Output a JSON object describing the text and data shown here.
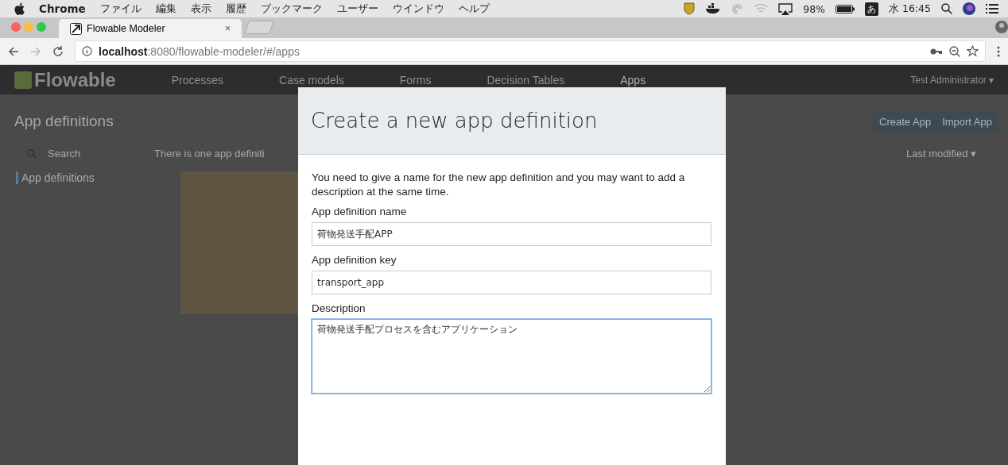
{
  "menu_bar": {
    "app": "Chrome",
    "items": [
      "ファイル",
      "編集",
      "表示",
      "履歴",
      "ブックマーク",
      "ユーザー",
      "ウインドウ",
      "ヘルプ"
    ],
    "battery": "98%",
    "input_method": "あ",
    "clock": "水 16:45"
  },
  "browser": {
    "tabs": [
      {
        "title": "Flowable Modeler",
        "close": "×",
        "selected": true
      }
    ],
    "url_host": "localhost",
    "url_path": ":8080/flowable-modeler/#/apps"
  },
  "app": {
    "logo": "Flowable",
    "nav": [
      {
        "label": "Processes",
        "selected": false
      },
      {
        "label": "Case models",
        "selected": false
      },
      {
        "label": "Forms",
        "selected": false
      },
      {
        "label": "Decision Tables",
        "selected": false
      },
      {
        "label": "Apps",
        "selected": true
      }
    ],
    "user": "Test Administrator ▾",
    "heading": "App definitions",
    "buttons": [
      "Create App",
      "Import App"
    ],
    "search": {
      "placeholder": "Search"
    },
    "summary": "There is one app definiti",
    "sort": "Last modified ▾",
    "sidebar": [
      {
        "label": "App definitions",
        "selected": true
      }
    ]
  },
  "dialog": {
    "title": "Create a new app definition",
    "intro": "You need to give a name for the new app definition and you may want to add a description at the same time.",
    "fields": [
      {
        "kind": "input",
        "label": "App definition name",
        "value": "荷物発送手配APP",
        "focused": false
      },
      {
        "kind": "input",
        "label": "App definition key",
        "value": "transport_app",
        "focused": false
      },
      {
        "kind": "textarea",
        "label": "Description",
        "value": "荷物発送手配プロセスを含むアプリケーション",
        "focused": true
      }
    ]
  }
}
